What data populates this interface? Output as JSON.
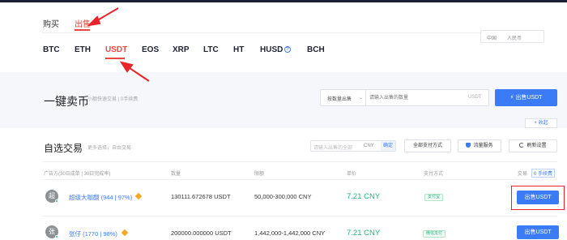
{
  "header": {
    "tabs": [
      {
        "label": "购买",
        "active": false
      },
      {
        "label": "出售",
        "active": true
      }
    ],
    "prefs": {
      "language": "中国",
      "currency": "人民币"
    },
    "coins": [
      "BTC",
      "ETH",
      "USDT",
      "EOS",
      "XRP",
      "LTC",
      "HT",
      "HUSD",
      "BCH"
    ],
    "active_coin": "USDT",
    "help_glyph": "?"
  },
  "quick_trade": {
    "title": "一键卖币",
    "subtitle": "小额快速交易 | 0手续费",
    "mode_select": "按数量出售",
    "amount_placeholder": "请输入出售的数量",
    "unit": "USDT",
    "button_label": "出售USDT",
    "collapse_label": "+ 收起"
  },
  "custom_trade": {
    "title": "自选交易",
    "subtitle": "更多选择，自由交易",
    "amount_placeholder": "请输入出售的全部",
    "amount_currency": "CNY",
    "confirm_label": "确定",
    "payment_filter_label": "全部支付方式",
    "protect_label": "流量服务",
    "refresh_label": "刷新设置",
    "columns": [
      "广告方(30日成单 | 30日完成率)",
      "数量",
      "限额",
      "单价",
      "支付方式",
      "交易",
      "0 手续费"
    ],
    "rows": [
      {
        "avatar_text": "超",
        "merchant": "超级大咖翻 (944 | 97%)",
        "quantity": "130111.672678 USDT",
        "limit": "50,000-300,000 CNY",
        "price": "7.21 CNY",
        "payment": "支付宝",
        "action": "出售USDT"
      },
      {
        "avatar_text": "张",
        "merchant": "张仔 (1770 | 98%)",
        "quantity": "200000.000000 USDT",
        "limit": "1,442,000-1,442,000 CNY",
        "price": "7.21 CNY",
        "payment": "微信支付",
        "action": "出售USDT"
      }
    ]
  },
  "colors": {
    "accent": "#3b7cf6",
    "active_red": "#e8453c",
    "price_green": "#1fb57c",
    "annotation_red": "#e8232a"
  }
}
